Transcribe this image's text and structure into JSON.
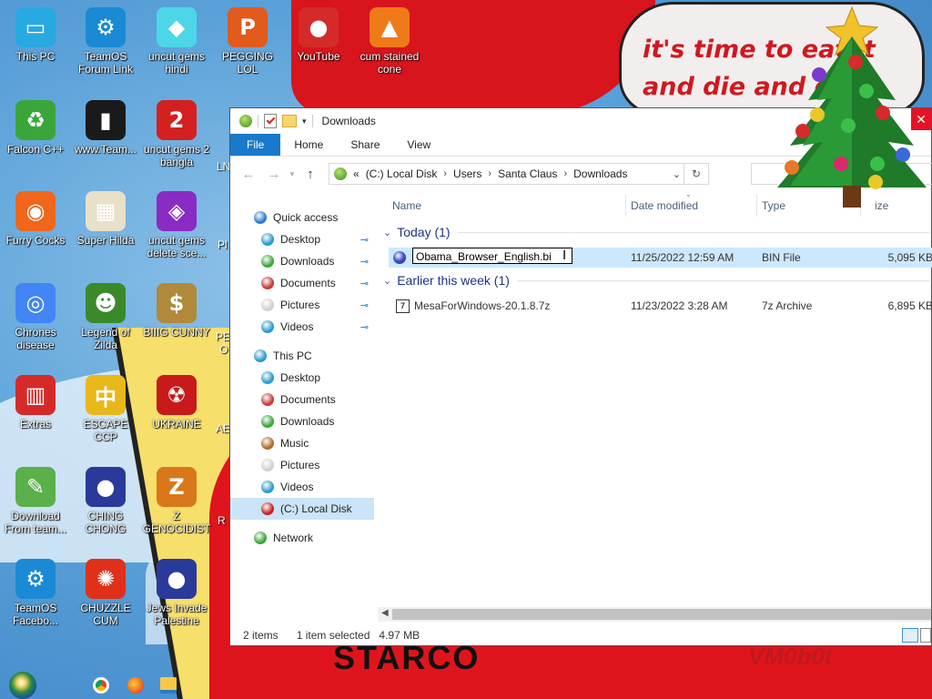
{
  "wallpaper": {
    "speech_line1": "it's time to eat it",
    "speech_line2": "and die and d",
    "bottom_left": "STARCO",
    "bottom_right": "VM0b0t"
  },
  "desktop_icons": [
    {
      "label": "This PC",
      "icon": "monitor-icon",
      "color": "#29a9e1"
    },
    {
      "label": "TeamOS Forum Link",
      "icon": "gear-icon",
      "color": "#1a8ad4"
    },
    {
      "label": "uncut gems hindi",
      "icon": "diamond-icon",
      "color": "#4dd6e8"
    },
    {
      "label": "PEGGING LOL",
      "icon": "p-logo-icon",
      "color": "#e25a1c"
    },
    {
      "label": "YouTube",
      "icon": "angry-bird-icon",
      "color": "#d52a2a"
    },
    {
      "label": "cum stained cone",
      "icon": "traffic-cone-icon",
      "color": "#f07a1a"
    },
    {
      "label": "Falcon C++",
      "icon": "recycle-icon",
      "color": "#3aa63a"
    },
    {
      "label": "www.Team...",
      "icon": "book-icon",
      "color": "#1a1a1a"
    },
    {
      "label": "uncut gems 2 bangla",
      "icon": "number-two-icon",
      "color": "#d42020"
    },
    {
      "label": "Furry Cocks",
      "icon": "firefox-icon",
      "color": "#f0661a"
    },
    {
      "label": "Super Hilda",
      "icon": "pixel-character-icon",
      "color": "#e8e0c8"
    },
    {
      "label": "uncut gems delete sce...",
      "icon": "gem-ring-icon",
      "color": "#8a2bc4"
    },
    {
      "label": "Chrones disease",
      "icon": "chrome-icon",
      "color": "#4285f4"
    },
    {
      "label": "Legend of Zilda",
      "icon": "pixel-hero-icon",
      "color": "#3a8a2a"
    },
    {
      "label": "BIIIG CUNNY",
      "icon": "money-bag-icon",
      "color": "#b08a3a"
    },
    {
      "label": "Extras",
      "icon": "red-book-icon",
      "color": "#d42a2a"
    },
    {
      "label": "ESCAPE CCP",
      "icon": "mahjong-icon",
      "color": "#e8b81a"
    },
    {
      "label": "UKRAINE",
      "icon": "radiation-icon",
      "color": "#c81a1a"
    },
    {
      "label": "Download From team...",
      "icon": "notepad-icon",
      "color": "#5ab04a"
    },
    {
      "label": "CHING CHONG",
      "icon": "orb-icon",
      "color": "#2a3a9a"
    },
    {
      "label": "Z GENOCIDIST",
      "icon": "z-icon",
      "color": "#d8781a"
    },
    {
      "label": "TeamOS Facebo...",
      "icon": "gear-icon",
      "color": "#1a8ad4"
    },
    {
      "label": "CHUZZLE CUM",
      "icon": "chuzzle-icon",
      "color": "#e0301a"
    },
    {
      "label": "Jews Invade Palestine",
      "icon": "orb-icon",
      "color": "#2a3a9a"
    }
  ],
  "partial_icon_labels": [
    "LN",
    "Pl",
    "PE",
    "O",
    "AE",
    "R"
  ],
  "explorer": {
    "title": "Downloads",
    "close_label": "✕",
    "ribbon_tabs": [
      "File",
      "Home",
      "Share",
      "View"
    ],
    "breadcrumb": {
      "prefix": "«",
      "items": [
        "(C:) Local Disk",
        "Users",
        "Santa Claus",
        "Downloads"
      ]
    },
    "sidebar": {
      "quick_access": {
        "label": "Quick access",
        "items": [
          "Desktop",
          "Downloads",
          "Documents",
          "Pictures",
          "Videos"
        ]
      },
      "this_pc": {
        "label": "This PC",
        "items": [
          "Desktop",
          "Documents",
          "Downloads",
          "Music",
          "Pictures",
          "Videos",
          "(C:) Local Disk"
        ]
      },
      "network": {
        "label": "Network"
      }
    },
    "columns": {
      "name": "Name",
      "date": "Date modified",
      "type": "Type",
      "size": "ize"
    },
    "groups": [
      {
        "label": "Today (1)",
        "files": [
          {
            "name": "Obama_Browser_English.bi",
            "date": "11/25/2022 12:59 AM",
            "type": "BIN File",
            "size": "5,095 KB",
            "selected": true,
            "renaming": true
          }
        ]
      },
      {
        "label": "Earlier this week (1)",
        "files": [
          {
            "name": "MesaForWindows-20.1.8.7z",
            "date": "11/23/2022 3:28 AM",
            "type": "7z Archive",
            "size": "6,895 KB",
            "selected": false,
            "renaming": false
          }
        ]
      }
    ],
    "status": {
      "items": "2 items",
      "selected": "1 item selected",
      "size": "4.97 MB"
    }
  }
}
